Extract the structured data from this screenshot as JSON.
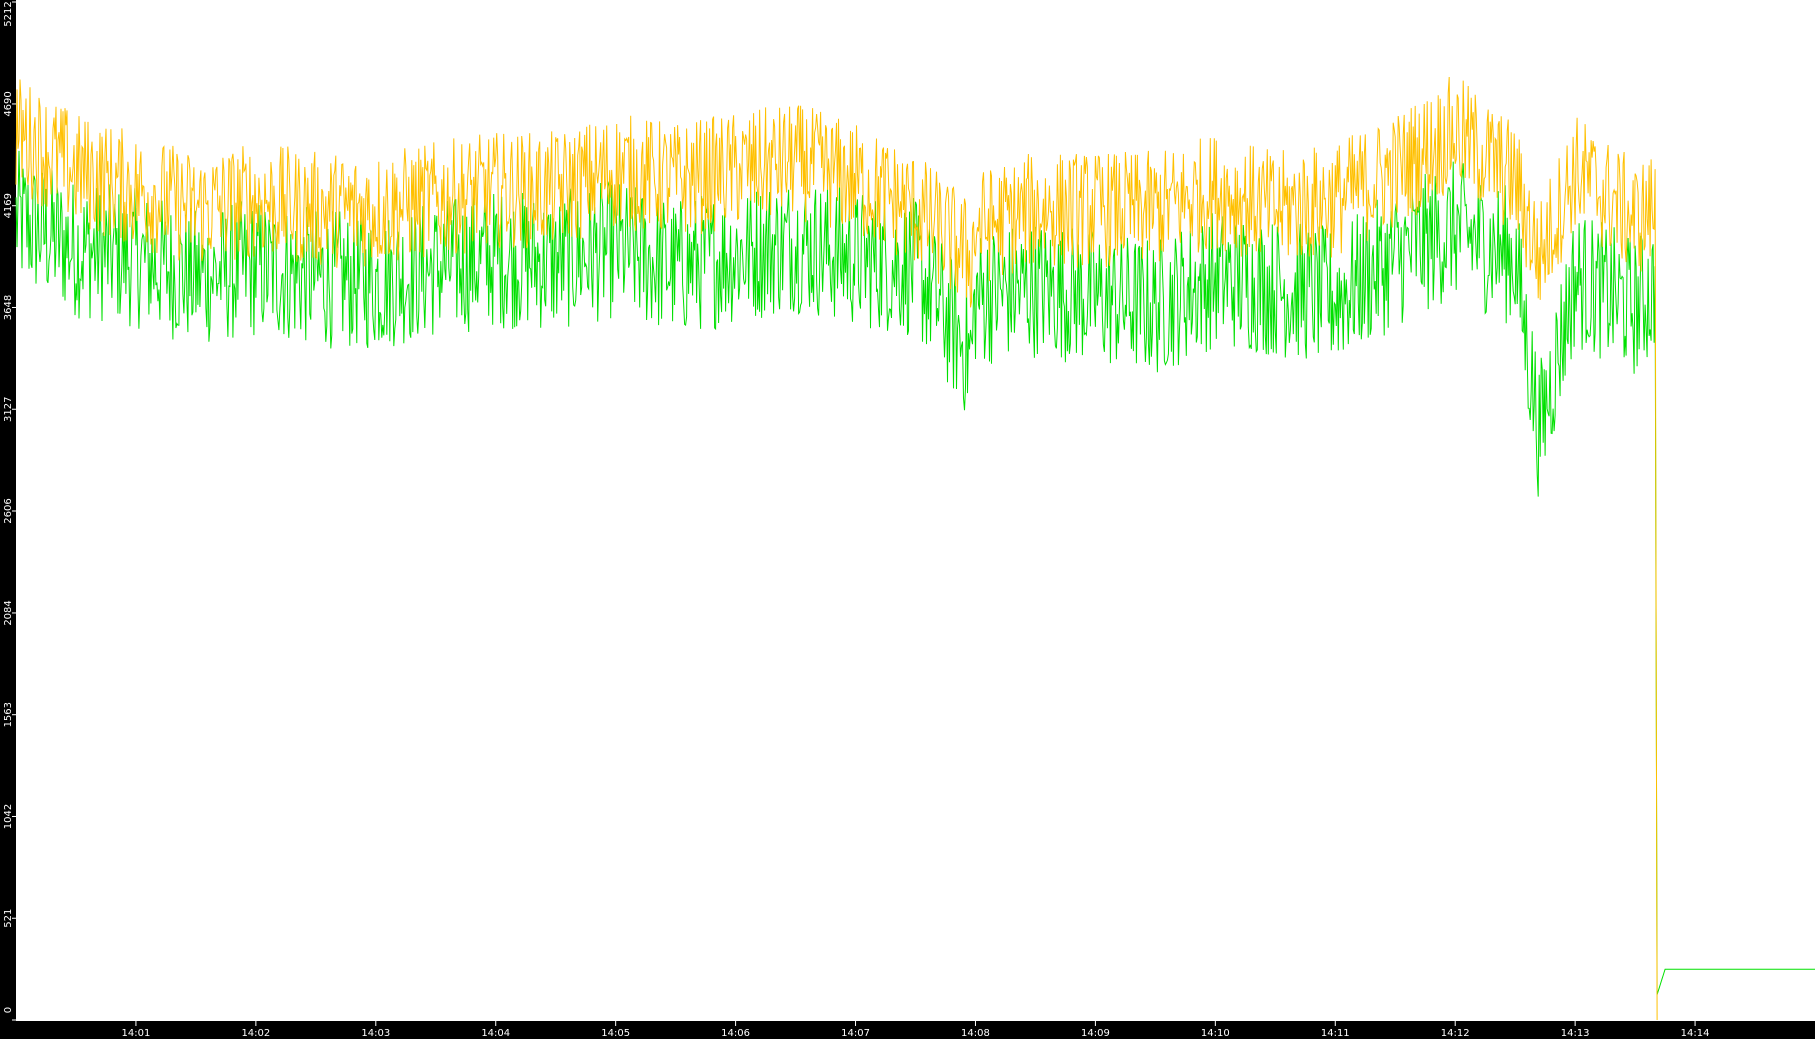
{
  "chart_data": {
    "type": "line",
    "title": "",
    "xlabel": "",
    "ylabel": "",
    "x_range": [
      "14:00:00",
      "14:15:00"
    ],
    "x_ticks": [
      "14:01",
      "14:02",
      "14:03",
      "14:04",
      "14:05",
      "14:06",
      "14:07",
      "14:08",
      "14:09",
      "14:10",
      "14:11",
      "14:12",
      "14:13",
      "14:14"
    ],
    "ylim": [
      0,
      5212
    ],
    "y_ticks": [
      "0",
      "521",
      "1042",
      "1563",
      "2084",
      "2606",
      "3127",
      "3648",
      "4169",
      "4690",
      "5212"
    ],
    "grid": false,
    "legend": "none",
    "colors": {
      "background": "#ffffff",
      "axis_band": "#000000",
      "axis_text": "#ffffff"
    },
    "series": [
      {
        "color": "#00e000",
        "points": [
          [
            "14:00:00",
            4100
          ],
          [
            "14:00:30",
            3950
          ],
          [
            "14:01:00",
            3900
          ],
          [
            "14:01:30",
            3800
          ],
          [
            "14:02:00",
            3850
          ],
          [
            "14:02:30",
            3800
          ],
          [
            "14:03:00",
            3780
          ],
          [
            "14:03:30",
            3850
          ],
          [
            "14:04:00",
            3900
          ],
          [
            "14:04:30",
            3880
          ],
          [
            "14:05:00",
            3950
          ],
          [
            "14:05:30",
            3850
          ],
          [
            "14:06:00",
            3920
          ],
          [
            "14:06:30",
            3980
          ],
          [
            "14:07:00",
            3900
          ],
          [
            "14:07:30",
            3850
          ],
          [
            "14:07:58",
            3400
          ],
          [
            "14:08:00",
            3700
          ],
          [
            "14:08:30",
            3750
          ],
          [
            "14:09:00",
            3700
          ],
          [
            "14:09:30",
            3650
          ],
          [
            "14:10:00",
            3800
          ],
          [
            "14:10:30",
            3750
          ],
          [
            "14:11:00",
            3700
          ],
          [
            "14:11:30",
            3900
          ],
          [
            "14:12:00",
            4050
          ],
          [
            "14:12:30",
            3900
          ],
          [
            "14:12:42",
            3000
          ],
          [
            "14:13:00",
            3800
          ],
          [
            "14:13:30",
            3650
          ],
          [
            "14:13:40",
            3750
          ],
          [
            "14:13:41",
            130
          ],
          [
            "14:13:45",
            260
          ],
          [
            "14:15:00",
            260
          ]
        ]
      },
      {
        "color": "#ffc000",
        "points": [
          [
            "14:00:00",
            4550
          ],
          [
            "14:00:30",
            4350
          ],
          [
            "14:01:00",
            4250
          ],
          [
            "14:01:30",
            4150
          ],
          [
            "14:02:00",
            4200
          ],
          [
            "14:02:30",
            4150
          ],
          [
            "14:03:00",
            4150
          ],
          [
            "14:03:30",
            4200
          ],
          [
            "14:04:00",
            4250
          ],
          [
            "14:04:30",
            4250
          ],
          [
            "14:05:00",
            4350
          ],
          [
            "14:05:30",
            4300
          ],
          [
            "14:06:00",
            4350
          ],
          [
            "14:06:30",
            4400
          ],
          [
            "14:07:00",
            4300
          ],
          [
            "14:07:30",
            4150
          ],
          [
            "14:07:58",
            3900
          ],
          [
            "14:08:00",
            4050
          ],
          [
            "14:08:30",
            4150
          ],
          [
            "14:09:00",
            4150
          ],
          [
            "14:09:30",
            4150
          ],
          [
            "14:10:00",
            4250
          ],
          [
            "14:10:30",
            4150
          ],
          [
            "14:11:00",
            4200
          ],
          [
            "14:11:30",
            4350
          ],
          [
            "14:12:00",
            4550
          ],
          [
            "14:12:30",
            4300
          ],
          [
            "14:12:42",
            3900
          ],
          [
            "14:13:00",
            4350
          ],
          [
            "14:13:30",
            4100
          ],
          [
            "14:13:40",
            4150
          ],
          [
            "14:13:41",
            0
          ]
        ]
      }
    ]
  }
}
